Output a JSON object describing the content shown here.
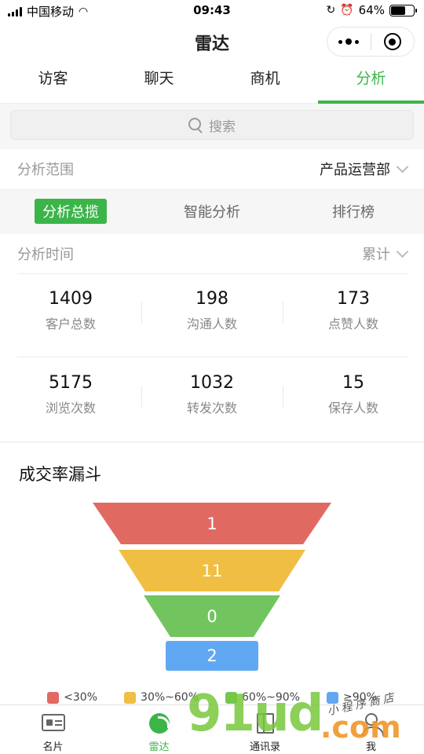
{
  "status_bar": {
    "carrier": "中国移动",
    "time": "09:43",
    "battery_percent": "64%",
    "battery_level": 0.64
  },
  "nav": {
    "title": "雷达"
  },
  "tabs": [
    {
      "label": "访客"
    },
    {
      "label": "聊天"
    },
    {
      "label": "商机"
    },
    {
      "label": "分析",
      "active": true
    }
  ],
  "search": {
    "placeholder": "搜索"
  },
  "scope": {
    "label": "分析范围",
    "value": "产品运营部"
  },
  "sub_tabs": [
    {
      "label": "分析总揽",
      "active": true
    },
    {
      "label": "智能分析"
    },
    {
      "label": "排行榜"
    }
  ],
  "time_filter": {
    "label": "分析时间",
    "value": "累计"
  },
  "stats": [
    {
      "value": "1409",
      "label": "客户总数"
    },
    {
      "value": "198",
      "label": "沟通人数"
    },
    {
      "value": "173",
      "label": "点赞人数"
    },
    {
      "value": "5175",
      "label": "浏览次数"
    },
    {
      "value": "1032",
      "label": "转发次数"
    },
    {
      "value": "15",
      "label": "保存人数"
    }
  ],
  "funnel": {
    "title": "成交率漏斗",
    "segments": [
      {
        "value": "1",
        "color": "#e06a62",
        "legend": "<30%"
      },
      {
        "value": "11",
        "color": "#f0be42",
        "legend": "30%~60%"
      },
      {
        "value": "0",
        "color": "#72c55e",
        "legend": "60%~90%"
      },
      {
        "value": "2",
        "color": "#61a8f2",
        "legend": "≥90%"
      }
    ]
  },
  "tab_bar": [
    {
      "label": "名片",
      "icon": "card-icon"
    },
    {
      "label": "雷达",
      "icon": "radar-icon",
      "active": true
    },
    {
      "label": "通讯录",
      "icon": "contacts-icon"
    },
    {
      "label": "我",
      "icon": "me-icon"
    }
  ],
  "watermark": {
    "text": "91ud",
    "domain": ".com",
    "caption": "小程序商店"
  }
}
